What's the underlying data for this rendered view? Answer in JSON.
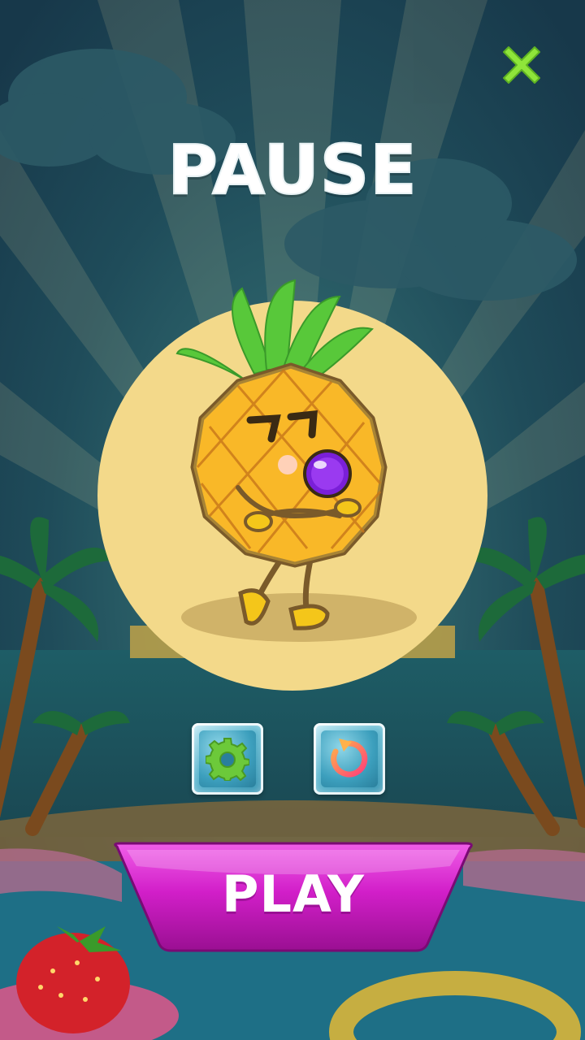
{
  "title": "PAUSE",
  "buttons": {
    "close_icon": "close-x-icon",
    "settings_icon": "gear-icon",
    "restart_icon": "restart-arrow-icon",
    "play_label": "PLAY"
  },
  "colors": {
    "close": "#8fe53a",
    "medallion": "#f3d98a",
    "play": "#d21fc9",
    "gear": "#6cc93a",
    "restart": "#ff6a5a"
  },
  "character": "pineapple-mascot"
}
